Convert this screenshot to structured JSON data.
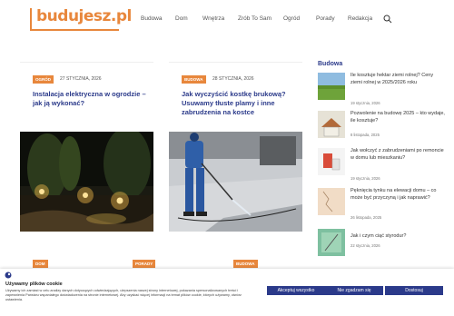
{
  "site": {
    "logo_text": "budujesz.pl"
  },
  "nav": {
    "items": [
      "Budowa",
      "Dom",
      "Wnętrza",
      "Zrób To Sam",
      "Ogród",
      "Porady",
      "Redakcja"
    ]
  },
  "cards": [
    {
      "category": "OGRÓD",
      "date": "27 STYCZNIA, 2026",
      "title": "Instalacja elektryczna w ogrodzie – jak ją wykonać?"
    },
    {
      "category": "BUDOWA",
      "date": "28 STYCZNIA, 2026",
      "title": "Jak wyczyścić kostkę brukową? Usuwamy tłuste plamy i inne zabrudzenia na kostce"
    }
  ],
  "sidebar": {
    "title": "Budowa",
    "items": [
      {
        "title": "Ile kosztuje hektar ziemi rolnej? Ceny ziemi rolnej w 2025/2026 roku",
        "date": "19 stycznia, 2026"
      },
      {
        "title": "Pozwolenie na budowę 2025 – kto wydaje, ile kosztuje?",
        "date": "8 listopada, 2025"
      },
      {
        "title": "Jak wołczyć z zabrudzeniami po remoncie w domu lub mieszkaniu?",
        "date": "19 stycznia, 2026"
      },
      {
        "title": "Pęknięcia tynku na elewacji domu – co może być przyczyną i jak naprawić?",
        "date": "26 listopada, 2025"
      },
      {
        "title": "Jak i czym ciąć styrodur?",
        "date": "22 stycznia, 2026"
      }
    ]
  },
  "lower_tags": [
    "DOM",
    "PORADY",
    "BUDOWA"
  ],
  "cookie": {
    "title": "Używamy plików cookie",
    "text": "Używamy ich zamiast w celu analizy danych dotyczących odwiedzających, ulepszenia naszej strony internetowej, pokazania spersonalizowanych treści i zapewnienia Państwu wspaniałego doświadczenia na stronie internetowej. Aby uzyskać więcej informacji na temat plików cookie, których używamy, otwórz ustawienia.",
    "accept_label": "Akceptuj wszystko",
    "reject_label": "Nie zgadzam się",
    "customize_label": "Dostosuj"
  },
  "colors": {
    "accent": "#e8873c",
    "link": "#2b3a8a",
    "button": "#2b3a8a"
  }
}
